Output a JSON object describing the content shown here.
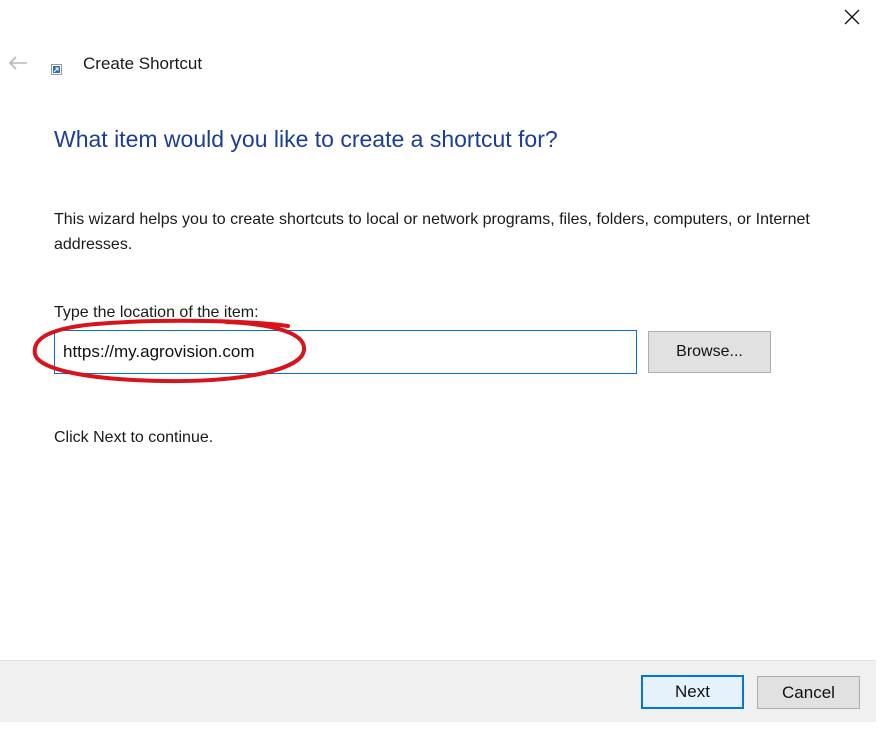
{
  "window": {
    "title": "Create Shortcut"
  },
  "wizard": {
    "heading": "What item would you like to create a shortcut for?",
    "description": "This wizard helps you to create shortcuts to local or network programs, files, folders, computers, or Internet addresses.",
    "location_label": "Type the location of the item:",
    "location_value": "https://my.agrovision.com",
    "browse_label": "Browse...",
    "continue_text": "Click Next to continue."
  },
  "footer": {
    "next_label": "Next",
    "cancel_label": "Cancel"
  },
  "colors": {
    "heading": "#1a3e96",
    "input_focus_border": "#0a6cce",
    "default_button_border": "#0078d7",
    "annotation": "#d8141a"
  },
  "icons": {
    "close": "close-icon",
    "back": "back-arrow-icon",
    "app": "shortcut-icon"
  }
}
